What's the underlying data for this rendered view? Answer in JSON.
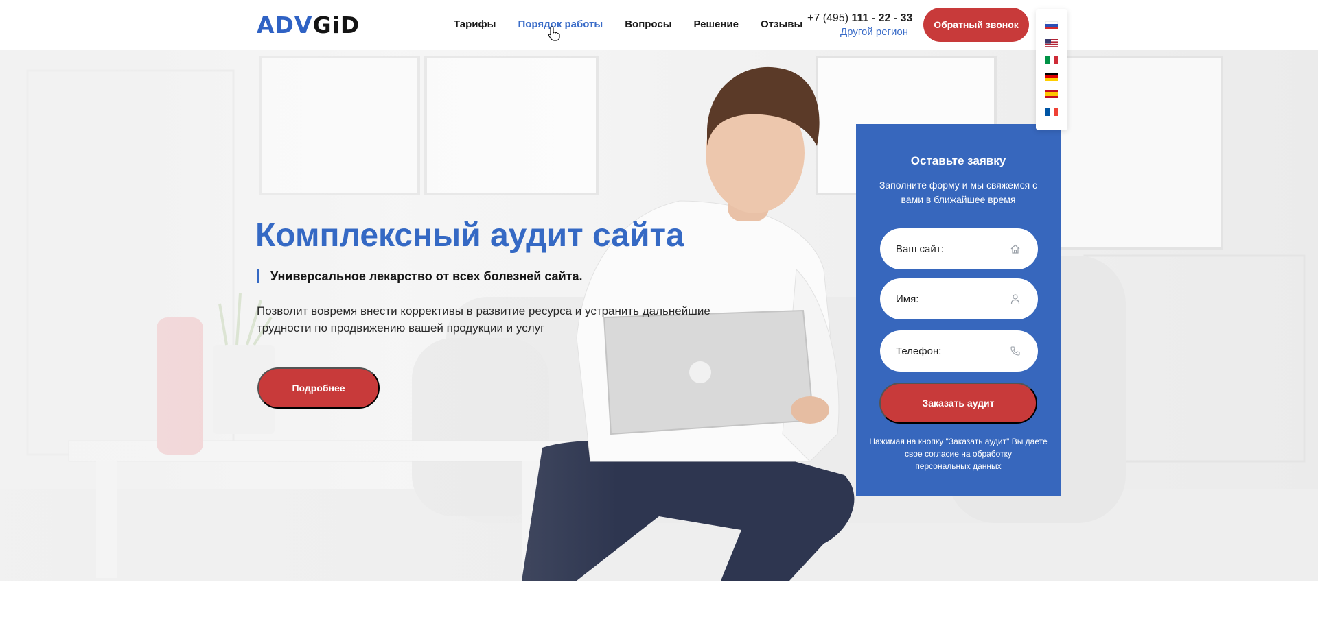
{
  "header": {
    "logo": {
      "part1": "ADV",
      "part2": "GiD"
    },
    "nav": [
      {
        "label": "Тарифы",
        "active": false
      },
      {
        "label": "Порядок работы",
        "active": true
      },
      {
        "label": "Вопросы",
        "active": false
      },
      {
        "label": "Решение",
        "active": false
      },
      {
        "label": "Отзывы",
        "active": false
      }
    ],
    "phone_prefix": "+7 (495) ",
    "phone_number": "111 - 22 - 33",
    "region_link": "Другой регион",
    "callback_label": "Обратный звонок"
  },
  "languages": [
    {
      "name": "russian-flag",
      "colors": [
        "#ffffff",
        "#2c4fb5",
        "#d52b2b"
      ]
    },
    {
      "name": "usa-flag",
      "colors": [
        "#b22234",
        "#ffffff",
        "#3c3b6e"
      ]
    },
    {
      "name": "italian-flag",
      "colors": [
        "#009246",
        "#ffffff",
        "#ce2b37"
      ]
    },
    {
      "name": "german-flag",
      "colors": [
        "#000000",
        "#dd0000",
        "#ffce00"
      ]
    },
    {
      "name": "spanish-flag",
      "colors": [
        "#c60b1e",
        "#ffc400",
        "#c60b1e"
      ]
    },
    {
      "name": "french-flag",
      "colors": [
        "#0055a4",
        "#ffffff",
        "#ef4135"
      ]
    }
  ],
  "hero": {
    "title": "Комплексный аудит сайта",
    "subtitle": "Универсальное лекарство от всех болезней сайта.",
    "text": "Позволит вовремя внести коррективы в развитие ресурса и устранить дальнейшие трудности по продвижению вашей продукции и услуг",
    "more_label": "Подробнее"
  },
  "form": {
    "title": "Оставьте заявку",
    "description": "Заполните форму и мы свяжемся с вами в ближайшее время",
    "fields": [
      {
        "placeholder": "Ваш сайт:",
        "icon": "home-icon"
      },
      {
        "placeholder": "Имя:",
        "icon": "user-icon"
      },
      {
        "placeholder": "Телефон:",
        "icon": "phone-icon"
      }
    ],
    "submit_label": "Заказать аудит",
    "consent_text": "Нажимая на кнопку \"Заказать аудит\" Вы даете свое согласие на обработку",
    "consent_link": "персональных данных"
  },
  "colors": {
    "accent_blue": "#3767bd",
    "accent_red": "#c83a3a",
    "title_blue": "#3569c4"
  }
}
